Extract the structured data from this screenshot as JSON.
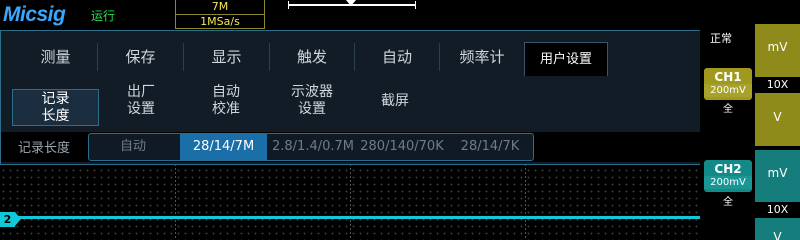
{
  "brand": {
    "logo": "Micsig",
    "run_status": "运行"
  },
  "acquisition": {
    "memory_depth": "7M",
    "sample_rate": "1MSa/s"
  },
  "menu": {
    "tabs": [
      {
        "label": "测量"
      },
      {
        "label": "保存"
      },
      {
        "label": "显示"
      },
      {
        "label": "触发"
      },
      {
        "label": "自动"
      },
      {
        "label": "频率计"
      },
      {
        "label": "用户设置"
      }
    ],
    "active_tab": "用户设置",
    "subtabs": [
      {
        "line1": "记录",
        "line2": "长度"
      },
      {
        "line1": "出厂",
        "line2": "设置"
      },
      {
        "line1": "自动",
        "line2": "校准"
      },
      {
        "line1": "示波器",
        "line2": "设置"
      },
      {
        "line1": "截屏",
        "line2": ""
      }
    ],
    "active_subtab": "记录长度",
    "record_length": {
      "label": "记录长度",
      "options": [
        {
          "label": "自动"
        },
        {
          "label": "28/14/7M"
        },
        {
          "label": "2.8/1.4/0.7M"
        },
        {
          "label": "280/140/70K"
        },
        {
          "label": "28/14/7K"
        }
      ],
      "selected": "28/14/7M"
    }
  },
  "channels": {
    "trigger_mode": "正常",
    "ch1": {
      "name": "CH1",
      "scale": "200mV",
      "coupling": "全",
      "unit_top": "mV",
      "probe": "10X",
      "unit_bottom": "V",
      "color": "#9f9a1f"
    },
    "ch2": {
      "name": "CH2",
      "scale": "200mV",
      "coupling": "全",
      "unit_top": "mV",
      "probe": "10X",
      "unit_bottom": "V",
      "color": "#138a88"
    }
  },
  "waveform": {
    "channel_marker": "2",
    "trace_color": "#10c8d8"
  }
}
